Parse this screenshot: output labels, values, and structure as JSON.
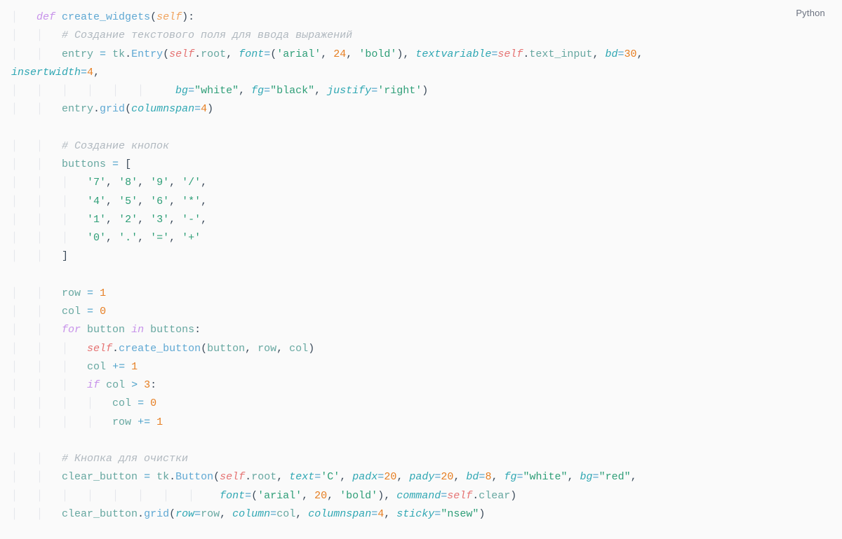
{
  "language_label": "Python",
  "code": {
    "line1_def": "def",
    "line1_fn": "create_widgets",
    "line1_self": "self",
    "line2_comment": "# Создание текстового поля для ввода выражений",
    "line3_var": "entry",
    "line3_tk": "tk",
    "line3_Entry": "Entry",
    "line3_selfroot_self": "self",
    "line3_selfroot_root": "root",
    "line3_font_kw": "font",
    "line3_font_arial": "'arial'",
    "line3_font_size": "24",
    "line3_font_bold": "'bold'",
    "line3_tv_kw": "textvariable",
    "line3_self2": "self",
    "line3_text_input": "text_input",
    "line3_bd_kw": "bd",
    "line3_bd_val": "30",
    "line4_iw_kw": "insertwidth",
    "line4_iw_val": "4",
    "line5_bg_kw": "bg",
    "line5_bg_val": "\"white\"",
    "line5_fg_kw": "fg",
    "line5_fg_val": "\"black\"",
    "line5_jf_kw": "justify",
    "line5_jf_val": "'right'",
    "line6_entry": "entry",
    "line6_grid": "grid",
    "line6_cs_kw": "columnspan",
    "line6_cs_val": "4",
    "line8_comment": "# Создание кнопок",
    "line9_buttons": "buttons",
    "row1_a": "'7'",
    "row1_b": "'8'",
    "row1_c": "'9'",
    "row1_d": "'/'",
    "row2_a": "'4'",
    "row2_b": "'5'",
    "row2_c": "'6'",
    "row2_d": "'*'",
    "row3_a": "'1'",
    "row3_b": "'2'",
    "row3_c": "'3'",
    "row3_d": "'-'",
    "row4_a": "'0'",
    "row4_b": "'.'",
    "row4_c": "'='",
    "row4_d": "'+'",
    "rowvar": "row",
    "rowval": "1",
    "colvar": "col",
    "colval": "0",
    "for_kw": "for",
    "in_kw": "in",
    "button_var": "button",
    "buttons_var": "buttons",
    "create_button_self": "self",
    "create_button_fn": "create_button",
    "cb_arg1": "button",
    "cb_arg2": "row",
    "cb_arg3": "col",
    "colinc": "col",
    "plusone": "1",
    "if_kw": "if",
    "ifcol": "col",
    "gt": ">",
    "three": "3",
    "col0": "col",
    "zero": "0",
    "rowinc": "row",
    "comment_clear": "# Кнопка для очистки",
    "clear_var": "clear_button",
    "tk2": "tk",
    "Button": "Button",
    "cb_self": "self",
    "cb_root": "root",
    "text_kw": "text",
    "text_val": "'C'",
    "padx_kw": "padx",
    "padx_val": "20",
    "pady_kw": "pady",
    "pady_val": "20",
    "bd2_kw": "bd",
    "bd2_val": "8",
    "fg2_kw": "fg",
    "fg2_val": "\"white\"",
    "bg2_kw": "bg",
    "bg2_val": "\"red\"",
    "font2_kw": "font",
    "font2_arial": "'arial'",
    "font2_size": "20",
    "font2_bold": "'bold'",
    "cmd_kw": "command",
    "cmd_self": "self",
    "cmd_clear": "clear",
    "grid2": "grid",
    "row_kw": "row",
    "row_arg": "row",
    "col_kw": "column",
    "col_arg": "col",
    "cs2_kw": "columnspan",
    "cs2_val": "4",
    "sticky_kw": "sticky",
    "sticky_val": "\"nsew\""
  }
}
